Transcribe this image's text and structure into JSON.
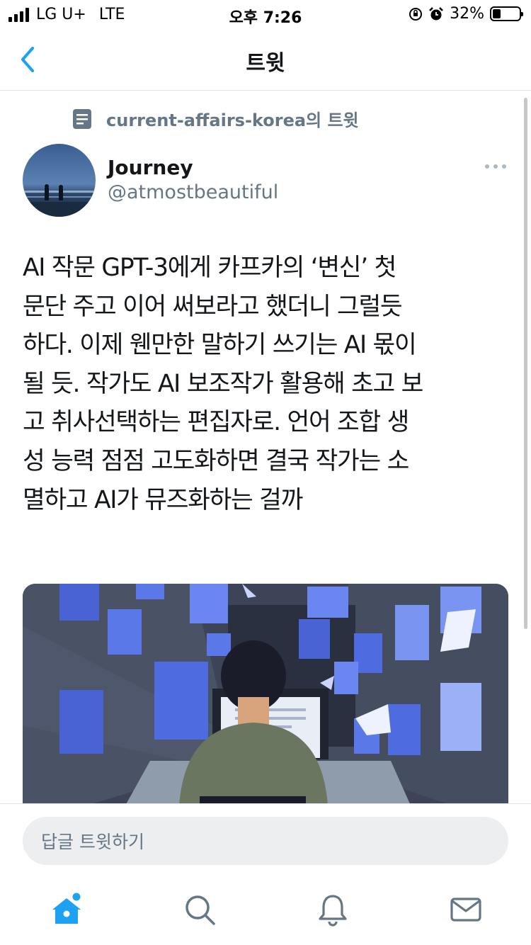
{
  "status_bar": {
    "carrier": "LG U+",
    "network": "LTE",
    "time": "오후 7:26",
    "battery": "32%",
    "battery_level": 0.32
  },
  "nav": {
    "title": "트윗",
    "back_icon": "chevron-left-icon"
  },
  "context": {
    "text": "current-affairs-korea의 트윗",
    "icon": "document-icon"
  },
  "author": {
    "name": "Journey",
    "handle": "@atmostbeautiful"
  },
  "tweet": {
    "text": "AI 작문 GPT-3에게 카프카의 ‘변신’ 첫\n문단 주고 이어 써보라고 했더니 그럴듯\n하다. 이제 웬만한 말하기 쓰기는 AI 몫이\n될 듯. 작가도 AI 보조작가 활용해 초고 보\n고 취사선택하는 편집자로. 언어 조합 생\n성 능력 점점 고도화하면 결국 작가는 소\n멸하고 AI가 뮤즈화하는 걸까"
  },
  "reply": {
    "placeholder": "답글 트윗하기"
  },
  "tabs": [
    {
      "name": "home",
      "icon": "home-icon"
    },
    {
      "name": "search",
      "icon": "search-icon"
    },
    {
      "name": "notifications",
      "icon": "bell-icon"
    },
    {
      "name": "messages",
      "icon": "mail-icon"
    }
  ],
  "colors": {
    "accent": "#1da1f2",
    "secondary_text": "#657786",
    "tab_icon": "#657786",
    "divider": "#e1e8ed"
  }
}
